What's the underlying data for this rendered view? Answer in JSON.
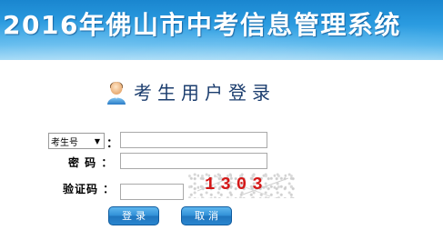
{
  "header": {
    "title": "2016年佛山市中考信息管理系统"
  },
  "login": {
    "title": "考生用户登录",
    "user_type_selected": "考生号",
    "colon": "：",
    "password_label": "密 码 ：",
    "captcha_label": "验证码 ：",
    "captcha_value": "1303",
    "username_value": "",
    "password_value": "",
    "captcha_input_value": ""
  },
  "buttons": {
    "login": "登录",
    "cancel": "取消"
  },
  "colors": {
    "banner_blue": "#2a9be0",
    "heading_text": "#1b3d6e",
    "captcha_red": "#d41818",
    "button_blue": "#2a86cf"
  },
  "icons": {
    "user": "user-icon",
    "dropdown": "chevron-down-icon"
  }
}
